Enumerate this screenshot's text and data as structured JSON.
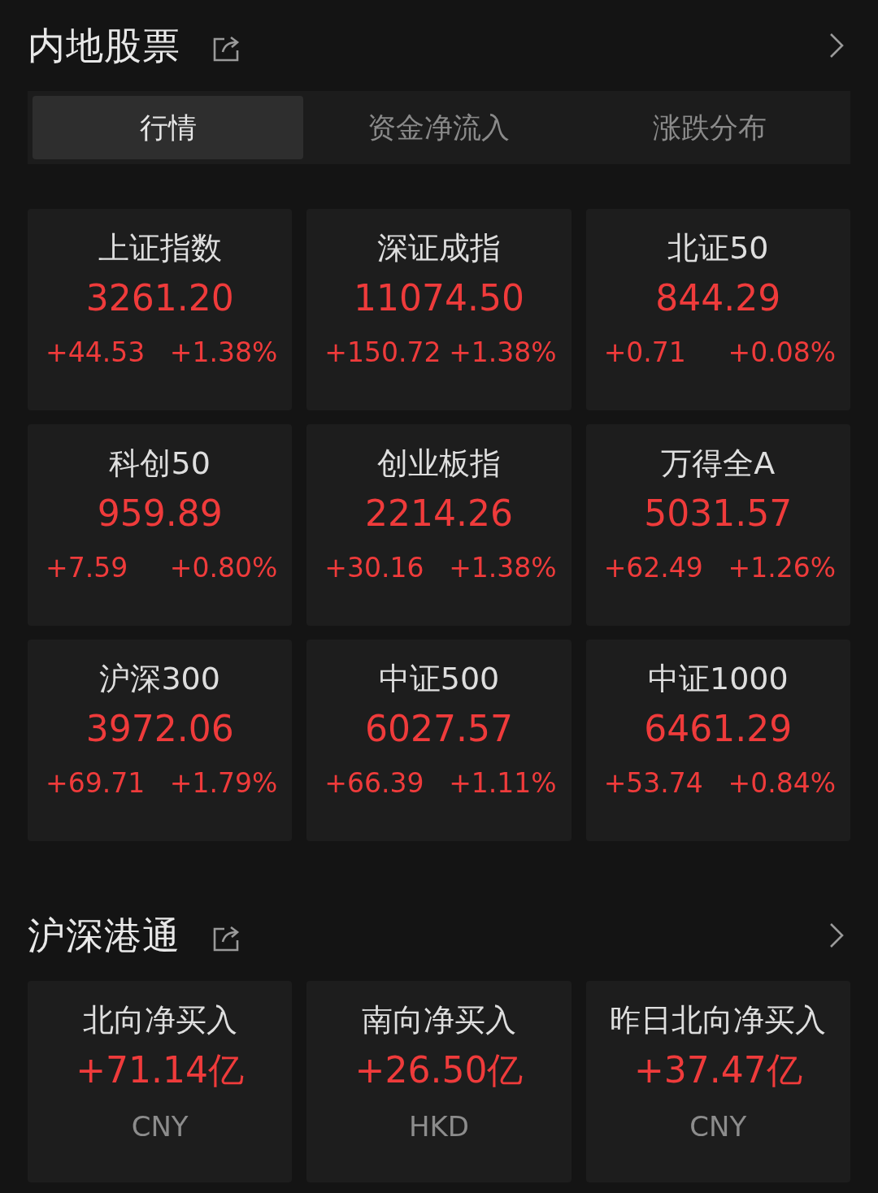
{
  "sections": [
    {
      "title": "内地股票",
      "tabs": [
        {
          "label": "行情",
          "selected": true
        },
        {
          "label": "资金净流入",
          "selected": false
        },
        {
          "label": "涨跌分布",
          "selected": false
        }
      ],
      "indices": [
        {
          "name": "上证指数",
          "value": "3261.20",
          "change": "+44.53",
          "percent": "+1.38%"
        },
        {
          "name": "深证成指",
          "value": "11074.50",
          "change": "+150.72",
          "percent": "+1.38%"
        },
        {
          "name": "北证50",
          "value": "844.29",
          "change": "+0.71",
          "percent": "+0.08%"
        },
        {
          "name": "科创50",
          "value": "959.89",
          "change": "+7.59",
          "percent": "+0.80%"
        },
        {
          "name": "创业板指",
          "value": "2214.26",
          "change": "+30.16",
          "percent": "+1.38%"
        },
        {
          "name": "万得全A",
          "value": "5031.57",
          "change": "+62.49",
          "percent": "+1.26%"
        },
        {
          "name": "沪深300",
          "value": "3972.06",
          "change": "+69.71",
          "percent": "+1.79%"
        },
        {
          "name": "中证500",
          "value": "6027.57",
          "change": "+66.39",
          "percent": "+1.11%"
        },
        {
          "name": "中证1000",
          "value": "6461.29",
          "change": "+53.74",
          "percent": "+0.84%"
        }
      ]
    },
    {
      "title": "沪深港通",
      "flows": [
        {
          "name": "北向净买入",
          "value": "+71.14亿",
          "currency": "CNY"
        },
        {
          "name": "南向净买入",
          "value": "+26.50亿",
          "currency": "HKD"
        },
        {
          "name": "昨日北向净买入",
          "value": "+37.47亿",
          "currency": "CNY"
        }
      ]
    }
  ]
}
